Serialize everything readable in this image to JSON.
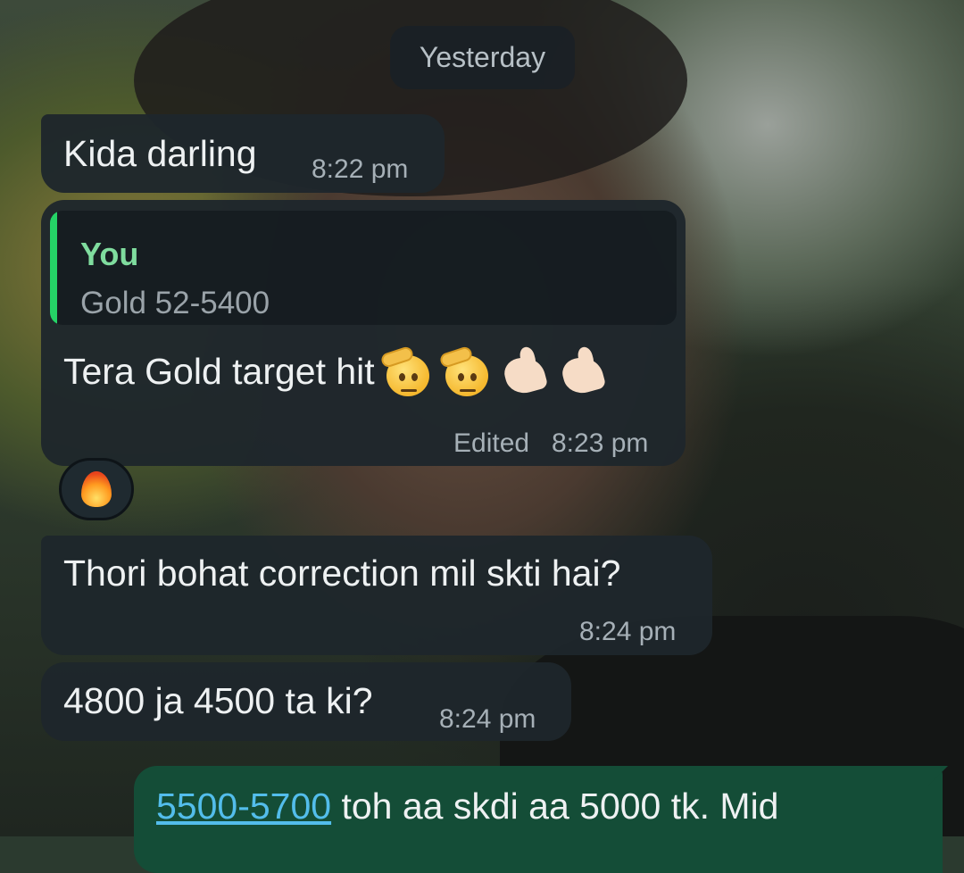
{
  "date_separator": "Yesterday",
  "messages": [
    {
      "text": "Kida darling",
      "time": "8:22 pm"
    },
    {
      "quote": {
        "author": "You",
        "text": "Gold 52-5400"
      },
      "text": "Tera Gold target hit",
      "emojis": [
        "saluting-face",
        "saluting-face",
        "flexed-biceps",
        "flexed-biceps"
      ],
      "edited_label": "Edited",
      "time": "8:23 pm",
      "reaction": "fire"
    },
    {
      "text": "Thori bohat correction mil skti hai?",
      "time": "8:24 pm"
    },
    {
      "text": "4800 ja 4500 ta ki?",
      "time": "8:24 pm"
    }
  ],
  "outgoing": {
    "link_text": "5500-5700",
    "text": " toh aa skdi aa 5000 tk. Mid"
  },
  "colors": {
    "incoming_bubble": "#1e262c",
    "outgoing_bubble": "#144d37",
    "quote_bar": "#25d366",
    "link": "#53bdeb"
  }
}
